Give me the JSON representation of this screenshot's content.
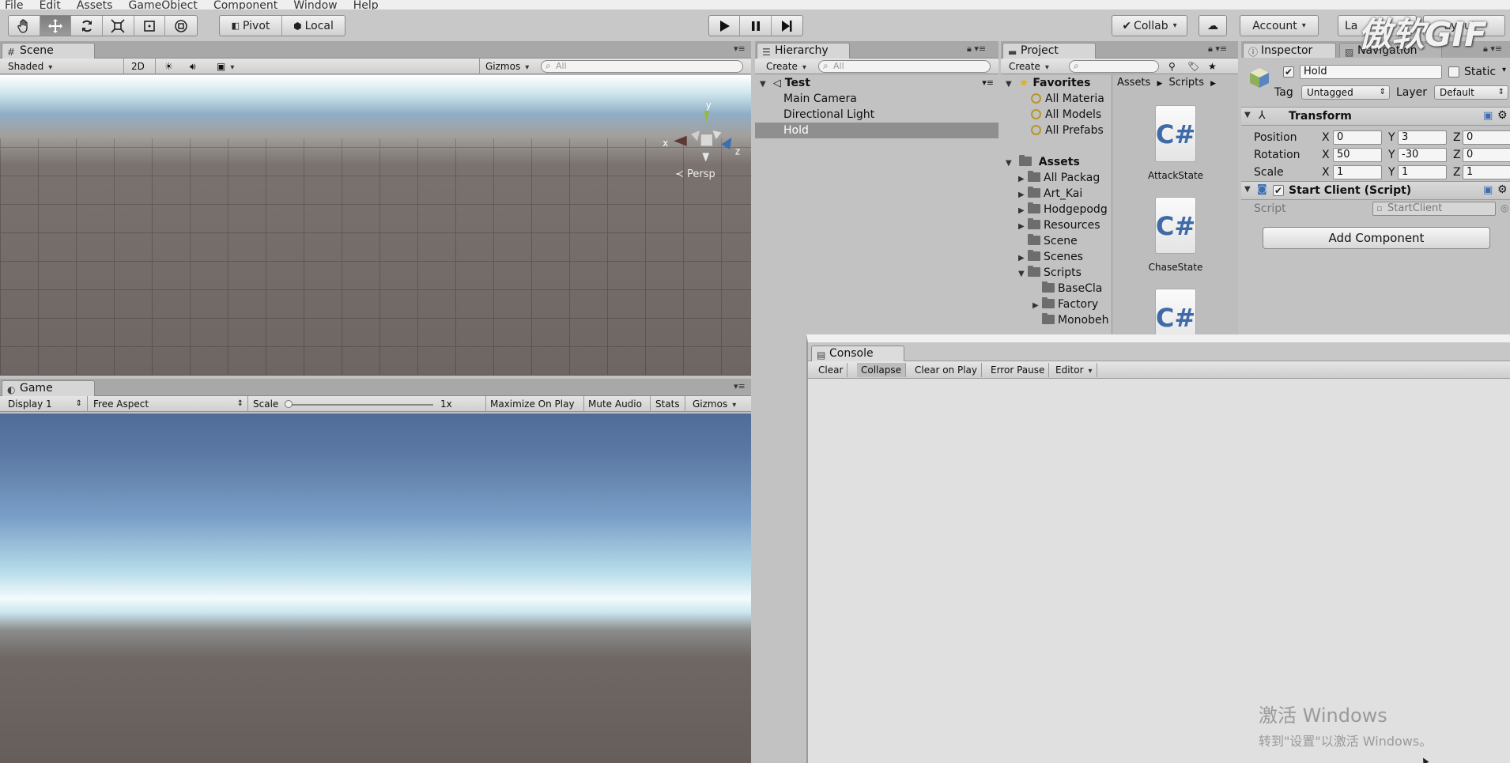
{
  "menu": [
    "File",
    "Edit",
    "Assets",
    "GameObject",
    "Component",
    "Window",
    "Help"
  ],
  "toolbar": {
    "pivot": "Pivot",
    "local": "Local",
    "collab": "Collab",
    "account": "Account",
    "layers": "La",
    "layout": "ayout"
  },
  "scene": {
    "tab": "Scene",
    "shading": "Shaded",
    "mode2d": "2D",
    "gizmos": "Gizmos",
    "search_placeholder": "All",
    "persp": "Persp",
    "axis_x": "x",
    "axis_y": "y",
    "axis_z": "z"
  },
  "game": {
    "tab": "Game",
    "display": "Display 1",
    "aspect": "Free Aspect",
    "scale_label": "Scale",
    "scale_value": "1x",
    "maximize": "Maximize On Play",
    "mute": "Mute Audio",
    "stats": "Stats",
    "gizmos": "Gizmos"
  },
  "hierarchy": {
    "tab": "Hierarchy",
    "create": "Create",
    "search_placeholder": "All",
    "scene_name": "Test",
    "items": [
      "Main Camera",
      "Directional Light",
      "Hold"
    ],
    "selected": "Hold"
  },
  "project": {
    "tab": "Project",
    "create": "Create",
    "favorites_label": "Favorites",
    "favorites": [
      "All Materia",
      "All Models",
      "All Prefabs"
    ],
    "assets_label": "Assets",
    "folders": [
      "All Packag",
      "Art_Kai",
      "Hodgepodg",
      "Resources",
      "Scene",
      "Scenes",
      "Scripts"
    ],
    "script_folders": [
      "BaseCla",
      "Factory",
      "Monobeh"
    ],
    "breadcrumb": [
      "Assets",
      "Scripts"
    ],
    "files": [
      "AttackState",
      "ChaseState"
    ]
  },
  "inspector": {
    "tab": "Inspector",
    "nav_tab": "Navigation",
    "object_name": "Hold",
    "static_label": "Static",
    "tag_label": "Tag",
    "tag_value": "Untagged",
    "layer_label": "Layer",
    "layer_value": "Default",
    "transform": {
      "title": "Transform",
      "position_label": "Position",
      "rotation_label": "Rotation",
      "scale_label": "Scale",
      "position": [
        "0",
        "3",
        "0"
      ],
      "rotation": [
        "50",
        "-30",
        "0"
      ],
      "scale": [
        "1",
        "1",
        "1"
      ]
    },
    "script_comp": {
      "title": "Start Client (Script)",
      "script_label": "Script",
      "script_value": "StartClient"
    },
    "add_component": "Add Component"
  },
  "console": {
    "tab": "Console",
    "buttons": [
      "Clear",
      "Collapse",
      "Clear on Play",
      "Error Pause",
      "Editor"
    ]
  },
  "watermark": {
    "line1": "激活 Windows",
    "line2": "转到\"设置\"以激活 Windows。",
    "gif": "傲软GIF"
  }
}
